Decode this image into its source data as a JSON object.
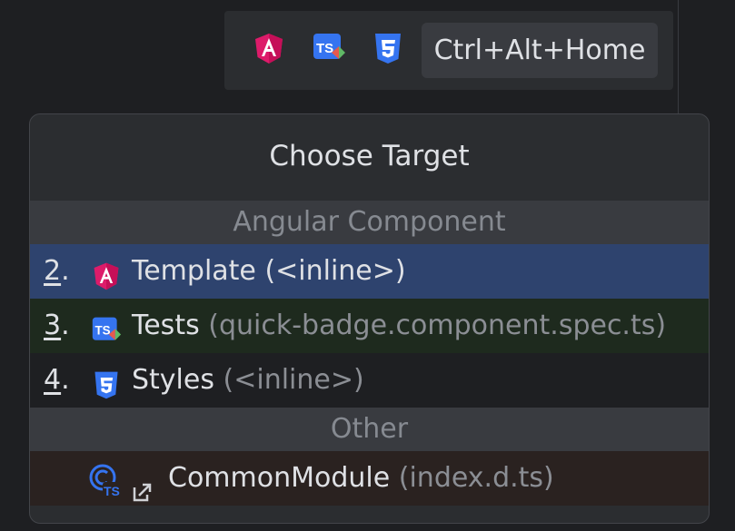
{
  "toolbar": {
    "icons": [
      "angular-icon",
      "typescript-test-icon",
      "css-icon"
    ],
    "shortcut": "Ctrl+Alt+Home"
  },
  "popup": {
    "title": "Choose Target",
    "sections": [
      {
        "header": "Angular Component",
        "items": [
          {
            "number": "2",
            "dot": ".",
            "icon": "angular-icon",
            "label": "Template",
            "detail": "(<inline>)",
            "selected": true
          },
          {
            "number": "3",
            "dot": ".",
            "icon": "typescript-test-icon",
            "label": "Tests",
            "detail": "(quick-badge.component.spec.ts)"
          },
          {
            "number": "4",
            "dot": ".",
            "icon": "css-icon",
            "label": "Styles",
            "detail": "(<inline>)"
          }
        ]
      },
      {
        "header": "Other",
        "items": [
          {
            "icon": "typescript-class-icon",
            "link_icon": "external-link-icon",
            "label": "CommonModule",
            "detail": "(index.d.ts)"
          }
        ]
      }
    ]
  },
  "colors": {
    "background": "#1e1f22",
    "panel": "#2b2d30",
    "selected_row": "#2e436e",
    "test_row": "#1e2a1e",
    "other_row": "#2a2220",
    "angular": "#dd1b6a",
    "typescript": "#3574f0",
    "css": "#3574f0"
  }
}
